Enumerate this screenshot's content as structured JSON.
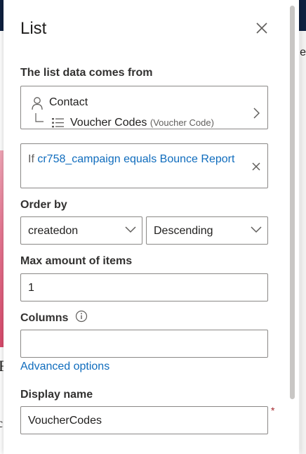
{
  "background": {
    "right_edge_text": "e",
    "bottom_left_text": "F",
    "bottom_left_text2": "c"
  },
  "panel": {
    "title": "List",
    "close_label": "Close",
    "data_source": {
      "label": "The list data comes from",
      "entity": "Contact",
      "related_list": "Voucher Codes",
      "related_list_schema": "(Voucher Code)"
    },
    "filter": {
      "prefix": "If",
      "condition": "cr758_campaign equals Bounce Report"
    },
    "order_by": {
      "label": "Order by",
      "field": "createdon",
      "direction": "Descending"
    },
    "max_items": {
      "label": "Max amount of items",
      "value": "1"
    },
    "columns": {
      "label": "Columns",
      "value": ""
    },
    "advanced_options": "Advanced options",
    "display_name": {
      "label": "Display name",
      "value": "VoucherCodes",
      "required_marker": "*"
    }
  },
  "colors": {
    "accent": "#0f6cbd",
    "top_bar": "#0f2140",
    "required": "#a4262c"
  }
}
